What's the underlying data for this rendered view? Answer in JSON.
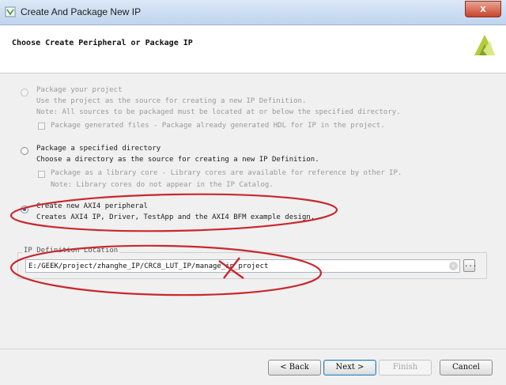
{
  "window": {
    "title": "Create And Package New IP",
    "close_icon": "close-icon",
    "close_glyph": "x"
  },
  "header": {
    "title": "Choose Create Peripheral or Package IP",
    "logo_icon": "vivado-logo-icon"
  },
  "options": [
    {
      "label": "Package your project",
      "desc1": "Use the project as the source for creating a new IP Definition.",
      "desc2": "Note: All sources to be packaged must be located at or below the specified directory.",
      "checkbox_label": "Package generated files - Package already generated HDL for IP in the project.",
      "enabled": false,
      "selected": false
    },
    {
      "label": "Package a specified directory",
      "desc1": "Choose a directory as the source for creating a new IP Definition.",
      "checkbox_label": "Package as a library core - Library cores are available for reference by other IP.",
      "checkbox_note": "Note: Library cores do not appear in the IP Catalog.",
      "enabled": true,
      "selected": false
    },
    {
      "label": "Create new AXI4 peripheral",
      "desc1": "Creates AXI4 IP, Driver, TestApp and the AXI4 BFM example design.",
      "enabled": true,
      "selected": true
    }
  ],
  "location": {
    "legend": "IP Definition Location",
    "value": "E:/GEEK/project/zhanghe_IP/CRC8_LUT_IP/manage_ip_project",
    "clear_icon": "clear-icon",
    "browse_label": "..."
  },
  "buttons": {
    "back": "< Back",
    "next": "Next >",
    "finish": "Finish",
    "cancel": "Cancel"
  },
  "colors": {
    "annotation": "#c8282d",
    "selected_radio": "#2d6aaa"
  }
}
